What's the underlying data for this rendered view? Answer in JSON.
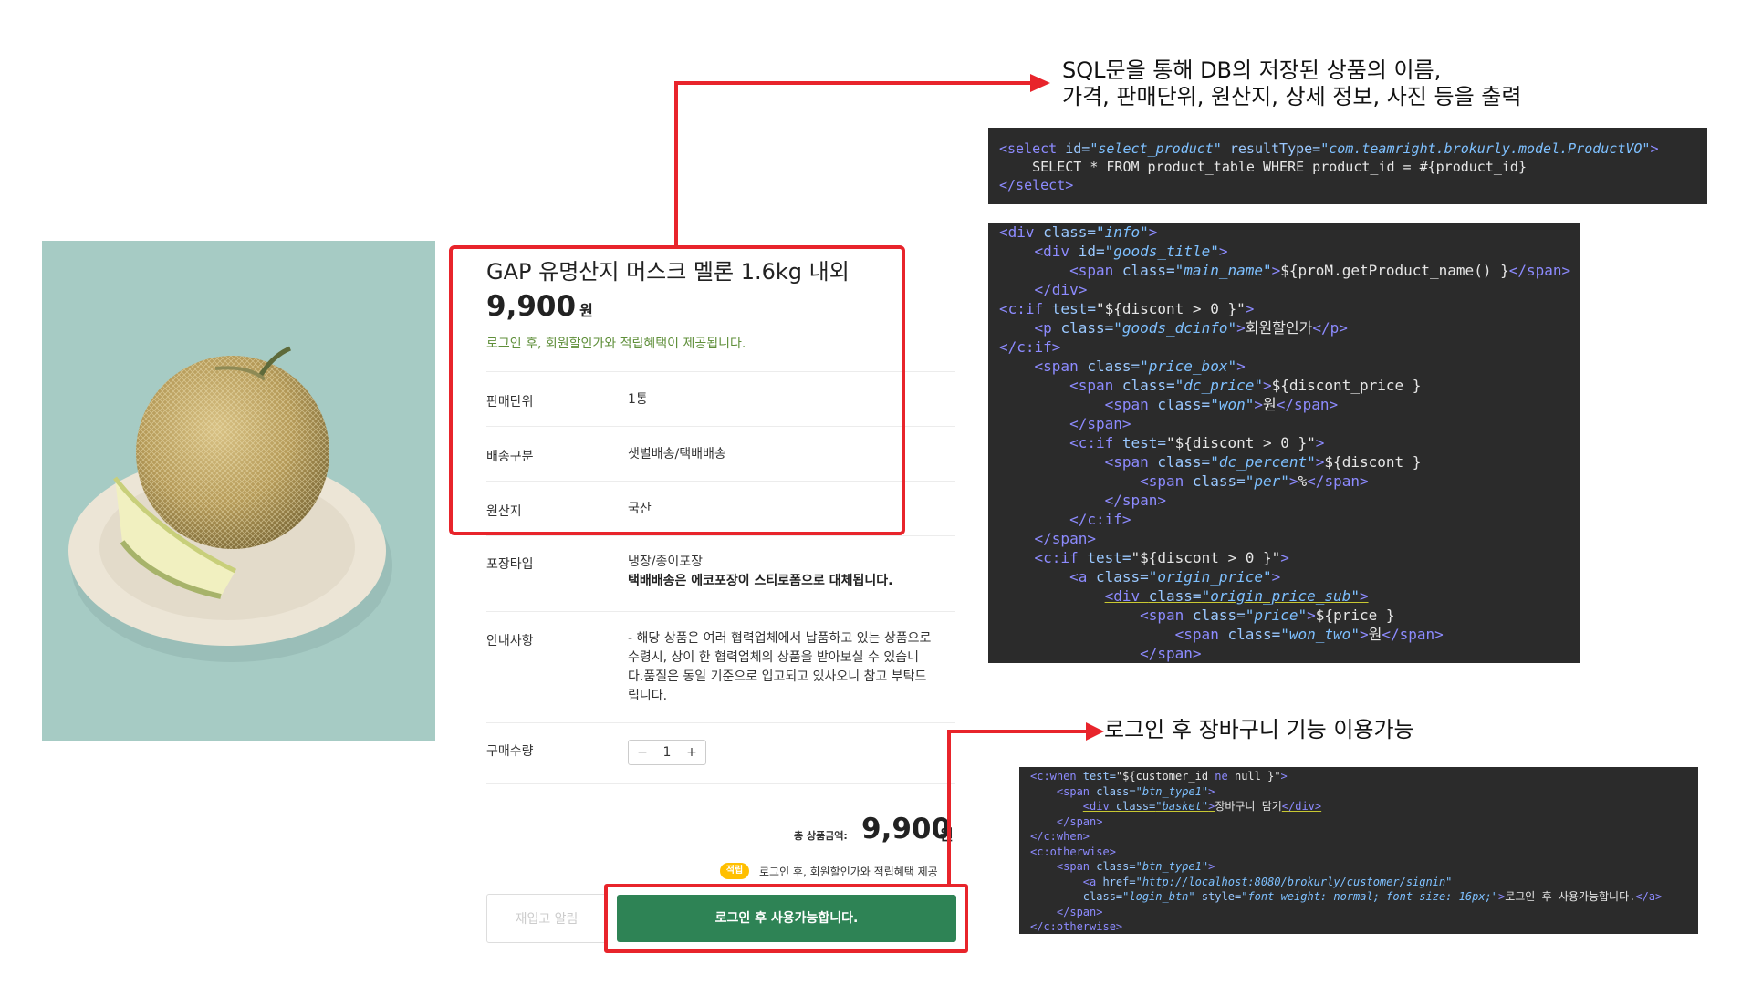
{
  "product": {
    "name": "GAP 유명산지 머스크 멜론 1.6kg 내외",
    "price": "9,900",
    "currency": "원",
    "login_info": "로그인 후, 회원할인가와 적립혜택이 제공됩니다.",
    "rows": [
      {
        "label": "판매단위",
        "value": "1통"
      },
      {
        "label": "배송구분",
        "value": "샛별배송/택배배송"
      },
      {
        "label": "원산지",
        "value": "국산"
      },
      {
        "label": "포장타입",
        "value": "냉장/종이포장",
        "value2": "택배배송은 에코포장이 스티로폼으로 대체됩니다."
      },
      {
        "label": "안내사항",
        "lines": [
          "- 해당 상품은 여러 협력업체에서 납품하고 있는 상품으로",
          "수령시, 상이 한 협력업체의 상품을 받아보실 수 있습니",
          "다.품질은 동일 기준으로 입고되고 있사오니 참고 부탁드",
          "립니다."
        ]
      }
    ],
    "quantity": {
      "label": "구매수량",
      "minus": "−",
      "value": "1",
      "plus": "+"
    },
    "total": {
      "label": "총 상품금액:",
      "value": "9,900",
      "currency": "원"
    },
    "point": {
      "badge": "적립",
      "text": "로그인 후, 회원할인가와 적립혜택 제공"
    },
    "buttons": {
      "restock": "재입고 알림",
      "cart": "로그인 후 사용가능합니다."
    }
  },
  "annotations": {
    "top_line1": "SQL문을 통해 DB의 저장된 상품의 이름,",
    "top_line2": "가격, 판매단위, 원산지, 상세 정보, 사진 등을 출력",
    "bottom": "로그인 후 장바구니 기능 이용가능"
  },
  "colors": {
    "highlight": "#e8242b",
    "cart_button": "#2e8355",
    "point_badge": "#ffbf00",
    "code_bg": "#2b2b2b",
    "code_tag": "#8d8bff",
    "code_string": "#7ec0ff"
  },
  "code": {
    "sql": [
      [
        [
          "tag",
          "<select "
        ],
        [
          "attr",
          "id="
        ],
        [
          "str",
          "\"select_product\" "
        ],
        [
          "attr",
          "resultType="
        ],
        [
          "str",
          "\"com.teamright.brokurly.model.ProductVO\""
        ],
        [
          "tag",
          ">"
        ]
      ],
      [
        [
          "txt",
          "    SELECT * FROM product_table WHERE product_id = #{product_id}"
        ]
      ],
      [
        [
          "tag",
          "</select>"
        ]
      ]
    ],
    "jsp": [
      [
        [
          "tag",
          "<div "
        ],
        [
          "attr",
          "class="
        ],
        [
          "str",
          "\"info\""
        ],
        [
          "tag",
          ">"
        ]
      ],
      [
        [
          "txt",
          "    "
        ],
        [
          "tag",
          "<div "
        ],
        [
          "attr",
          "id="
        ],
        [
          "str",
          "\"goods_title\""
        ],
        [
          "tag",
          ">"
        ]
      ],
      [
        [
          "txt",
          "        "
        ],
        [
          "tag",
          "<span "
        ],
        [
          "attr",
          "class="
        ],
        [
          "str",
          "\"main_name\""
        ],
        [
          "tag",
          ">"
        ],
        [
          "txt",
          "${proM.getProduct_name() }"
        ],
        [
          "tag",
          "</span>"
        ]
      ],
      [
        [
          "txt",
          "    "
        ],
        [
          "tag",
          "</div>"
        ]
      ],
      [
        [
          "tag",
          "<c:if "
        ],
        [
          "attr",
          "test="
        ],
        [
          "txt",
          "\"${discont > 0 }\""
        ],
        [
          "tag",
          ">"
        ]
      ],
      [
        [
          "txt",
          "    "
        ],
        [
          "tag",
          "<p "
        ],
        [
          "attr",
          "class="
        ],
        [
          "str",
          "\"goods_dcinfo\""
        ],
        [
          "tag",
          ">"
        ],
        [
          "txt",
          "회원할인가"
        ],
        [
          "tag",
          "</p>"
        ]
      ],
      [
        [
          "tag",
          "</c:if>"
        ]
      ],
      [
        [
          "txt",
          "    "
        ],
        [
          "tag",
          "<span "
        ],
        [
          "attr",
          "class="
        ],
        [
          "str",
          "\"price_box\""
        ],
        [
          "tag",
          ">"
        ]
      ],
      [
        [
          "txt",
          "        "
        ],
        [
          "tag",
          "<span "
        ],
        [
          "attr",
          "class="
        ],
        [
          "str",
          "\"dc_price\""
        ],
        [
          "tag",
          ">"
        ],
        [
          "txt",
          "${discont_price }"
        ]
      ],
      [
        [
          "txt",
          "            "
        ],
        [
          "tag",
          "<span "
        ],
        [
          "attr",
          "class="
        ],
        [
          "str",
          "\"won\""
        ],
        [
          "tag",
          ">"
        ],
        [
          "txt",
          "원"
        ],
        [
          "tag",
          "</span>"
        ]
      ],
      [
        [
          "txt",
          "        "
        ],
        [
          "tag",
          "</span>"
        ]
      ],
      [
        [
          "txt",
          "        "
        ],
        [
          "tag",
          "<c:if "
        ],
        [
          "attr",
          "test="
        ],
        [
          "txt",
          "\"${discont > 0 }\""
        ],
        [
          "tag",
          ">"
        ]
      ],
      [
        [
          "txt",
          "            "
        ],
        [
          "tag",
          "<span "
        ],
        [
          "attr",
          "class="
        ],
        [
          "str",
          "\"dc_percent\""
        ],
        [
          "tag",
          ">"
        ],
        [
          "txt",
          "${discont }"
        ]
      ],
      [
        [
          "txt",
          "                "
        ],
        [
          "tag",
          "<span "
        ],
        [
          "attr",
          "class="
        ],
        [
          "str",
          "\"per\""
        ],
        [
          "tag",
          ">"
        ],
        [
          "txt",
          "%"
        ],
        [
          "tag",
          "</span>"
        ]
      ],
      [
        [
          "txt",
          "            "
        ],
        [
          "tag",
          "</span>"
        ]
      ],
      [
        [
          "txt",
          "        "
        ],
        [
          "tag",
          "</c:if>"
        ]
      ],
      [
        [
          "txt",
          "    "
        ],
        [
          "tag",
          "</span>"
        ]
      ],
      [
        [
          "txt",
          "    "
        ],
        [
          "tag",
          "<c:if "
        ],
        [
          "attr",
          "test="
        ],
        [
          "txt",
          "\"${discont > 0 }\""
        ],
        [
          "tag",
          ">"
        ]
      ],
      [
        [
          "txt",
          "        "
        ],
        [
          "tag",
          "<a "
        ],
        [
          "attr",
          "class="
        ],
        [
          "str",
          "\"origin_price\""
        ],
        [
          "tag",
          ">"
        ]
      ],
      [
        [
          "txt",
          "            "
        ],
        [
          "tag",
          "<div "
        ],
        [
          "attr",
          "class="
        ],
        [
          "str",
          "\"origin_price_sub\""
        ],
        [
          "tag",
          ">"
        ]
      ],
      [
        [
          "txt",
          "                "
        ],
        [
          "tag",
          "<span "
        ],
        [
          "attr",
          "class="
        ],
        [
          "str",
          "\"price\""
        ],
        [
          "tag",
          ">"
        ],
        [
          "txt",
          "${price }"
        ]
      ],
      [
        [
          "txt",
          "                    "
        ],
        [
          "tag",
          "<span "
        ],
        [
          "attr",
          "class="
        ],
        [
          "str",
          "\"won_two\""
        ],
        [
          "tag",
          ">"
        ],
        [
          "txt",
          "원"
        ],
        [
          "tag",
          "</span>"
        ]
      ],
      [
        [
          "txt",
          "                "
        ],
        [
          "tag",
          "</span>"
        ]
      ]
    ],
    "cart": [
      [
        [
          "tag",
          "<c:when "
        ],
        [
          "attr",
          "test="
        ],
        [
          "txt",
          "\"${customer_id "
        ],
        [
          "tag",
          "ne"
        ],
        [
          "txt",
          " null }\""
        ],
        [
          "tag",
          ">"
        ]
      ],
      [
        [
          "txt",
          "    "
        ],
        [
          "tag",
          "<span "
        ],
        [
          "attr",
          "class="
        ],
        [
          "str",
          "\"btn_type1\""
        ],
        [
          "tag",
          ">"
        ]
      ],
      [
        [
          "txt",
          "        "
        ],
        [
          "tag",
          "<div "
        ],
        [
          "attr",
          "class="
        ],
        [
          "str",
          "\"basket\""
        ],
        [
          "tag",
          ">"
        ],
        [
          "txt",
          "장바구니 담기"
        ],
        [
          "tag",
          "</div>"
        ]
      ],
      [
        [
          "txt",
          "    "
        ],
        [
          "tag",
          "</span>"
        ]
      ],
      [
        [
          "tag",
          "</c:when>"
        ]
      ],
      [
        [
          "tag",
          "<c:otherwise>"
        ]
      ],
      [
        [
          "txt",
          "    "
        ],
        [
          "tag",
          "<span "
        ],
        [
          "attr",
          "class="
        ],
        [
          "str",
          "\"btn_type1\""
        ],
        [
          "tag",
          ">"
        ]
      ],
      [
        [
          "txt",
          "        "
        ],
        [
          "tag",
          "<a "
        ],
        [
          "attr",
          "href="
        ],
        [
          "str",
          "\"http://localhost:8080/brokurly/customer/signin\""
        ]
      ],
      [
        [
          "txt",
          "        "
        ],
        [
          "attr",
          "class="
        ],
        [
          "str",
          "\"login_btn\" "
        ],
        [
          "attr",
          "style="
        ],
        [
          "str",
          "\"font-weight: normal; font-size: 16px;\""
        ],
        [
          "tag",
          ">"
        ],
        [
          "txt",
          "로그인 후 사용가능합니다."
        ],
        [
          "tag",
          "</a>"
        ]
      ],
      [
        [
          "txt",
          "    "
        ],
        [
          "tag",
          "</span>"
        ]
      ],
      [
        [
          "tag",
          "</c:otherwise>"
        ]
      ]
    ]
  }
}
